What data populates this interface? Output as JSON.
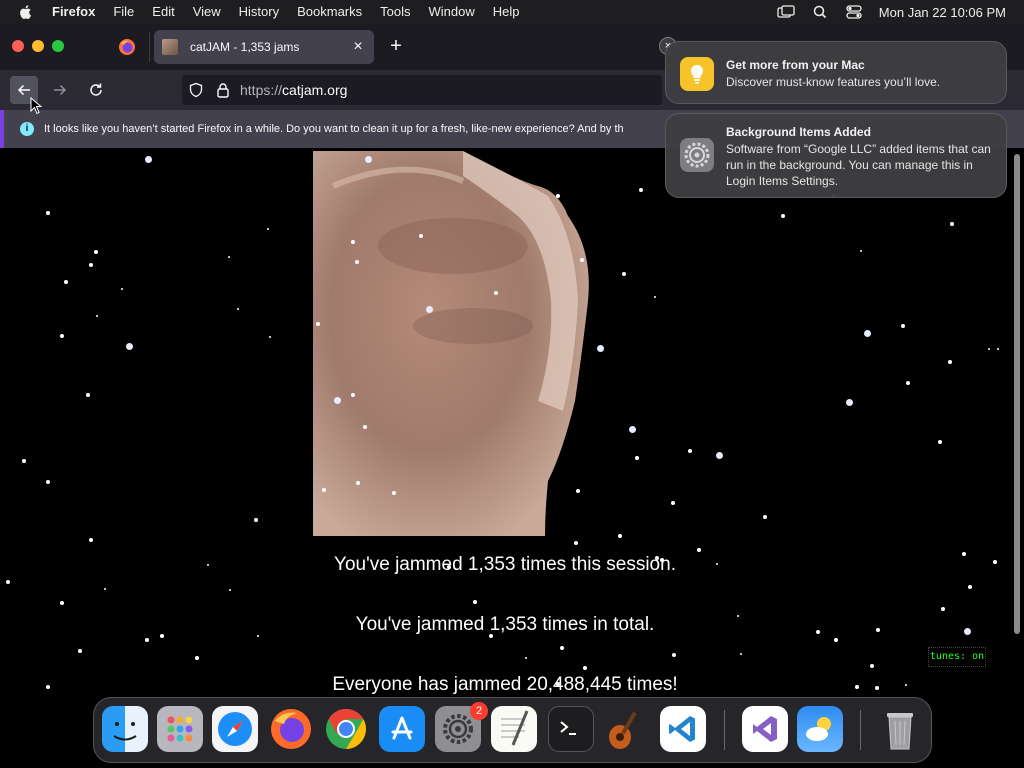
{
  "menubar": {
    "app_name": "Firefox",
    "items": [
      "File",
      "Edit",
      "View",
      "History",
      "Bookmarks",
      "Tools",
      "Window",
      "Help"
    ],
    "clock": "Mon Jan 22  10:06 PM"
  },
  "browser": {
    "tab_title": "catJAM - 1,353 jams",
    "tab_close": "×",
    "new_tab": "+",
    "url_proto": "https://",
    "url_host": "catjam.org",
    "info_message": "It looks like you haven’t started Firefox in a while. Do you want to clean it up for a fresh, like-new experience? And by th"
  },
  "page": {
    "session_line": "You've jammed 1,353 times this session.",
    "total_line": "You've jammed 1,353 times in total.",
    "everyone_line": "Everyone has jammed 20,488,445 times!",
    "tunes_toggle": "tunes: on"
  },
  "notifications": [
    {
      "title": "Get more from your Mac",
      "body": "Discover must-know features you’ll love.",
      "icon": "lightbulb-icon"
    },
    {
      "title": "Background Items Added",
      "body": "Software from “Google LLC” added items that can run in the background. You can manage this in Login Items Settings.",
      "icon": "gear-icon"
    }
  ],
  "notification_close": "×",
  "dock": {
    "apps": [
      "Finder",
      "Launchpad",
      "Safari",
      "Firefox",
      "Chrome",
      "App Store",
      "System Settings",
      "TextEdit",
      "Terminal",
      "GarageBand",
      "Visual Studio Code",
      "Visual Studio",
      "Weather",
      "Trash"
    ],
    "settings_badge": "2"
  },
  "colors": {
    "menubar": "#1e1e20",
    "tab_active": "#42414d",
    "navbar": "#2b2a33",
    "infobar_accent": "#7b3fe4",
    "tunes_text": "#22ff22",
    "page_background": "#000000"
  }
}
